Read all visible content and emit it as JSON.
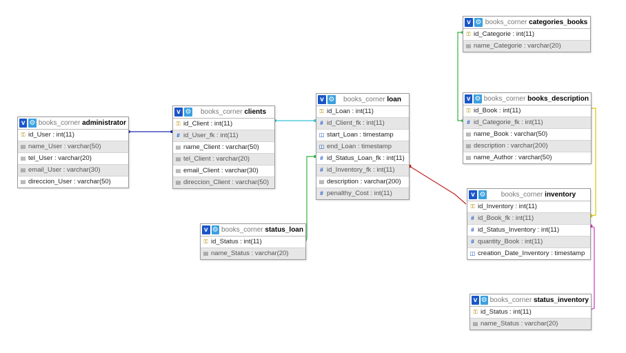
{
  "tables": {
    "administrator": {
      "db": "books_corner",
      "name": "administrator",
      "columns": [
        {
          "text": "id_User : int(11)",
          "icon": "key-icon"
        },
        {
          "text": "name_User : varchar(50)",
          "icon": "text-field-icon"
        },
        {
          "text": "tel_User : varchar(20)",
          "icon": "text-field-icon"
        },
        {
          "text": "email_User : varchar(30)",
          "icon": "text-field-icon"
        },
        {
          "text": "direccion_User : varchar(50)",
          "icon": "text-field-icon"
        }
      ]
    },
    "clients": {
      "db": "books_corner",
      "name": "clients",
      "columns": [
        {
          "text": "id_Client : int(11)",
          "icon": "key-icon"
        },
        {
          "text": "id_User_fk : int(11)",
          "icon": "number-field-icon"
        },
        {
          "text": "name_Client : varchar(50)",
          "icon": "text-field-icon"
        },
        {
          "text": "tel_Client : varchar(20)",
          "icon": "text-field-icon"
        },
        {
          "text": "email_Client : varchar(30)",
          "icon": "text-field-icon"
        },
        {
          "text": "direccion_Client : varchar(50)",
          "icon": "text-field-icon"
        }
      ]
    },
    "loan": {
      "db": "books_corner",
      "name": "loan",
      "columns": [
        {
          "text": "id_Loan : int(11)",
          "icon": "key-icon"
        },
        {
          "text": "id_Client_fk : int(11)",
          "icon": "number-field-icon"
        },
        {
          "text": "start_Loan : timestamp",
          "icon": "timestamp-field-icon"
        },
        {
          "text": "end_Loan : timestamp",
          "icon": "timestamp-field-icon"
        },
        {
          "text": "id_Status_Loan_fk : int(11)",
          "icon": "number-field-icon"
        },
        {
          "text": "id_Inventory_fk : int(11)",
          "icon": "number-field-icon"
        },
        {
          "text": "description : varchar(200)",
          "icon": "text-field-icon"
        },
        {
          "text": "penalthy_Cost : int(11)",
          "icon": "number-field-icon"
        }
      ]
    },
    "status_loan": {
      "db": "books_corner",
      "name": "status_loan",
      "columns": [
        {
          "text": "id_Status : int(11)",
          "icon": "key-icon"
        },
        {
          "text": "name_Status : varchar(20)",
          "icon": "text-field-icon"
        }
      ]
    },
    "categories_books": {
      "db": "books_corner",
      "name": "categories_books",
      "columns": [
        {
          "text": "id_Categorie : int(11)",
          "icon": "key-icon"
        },
        {
          "text": "name_Categorie : varchar(20)",
          "icon": "text-field-icon"
        }
      ]
    },
    "books_description": {
      "db": "books_corner",
      "name": "books_description",
      "columns": [
        {
          "text": "id_Book : int(11)",
          "icon": "key-icon"
        },
        {
          "text": "id_Categorie_fk : int(11)",
          "icon": "number-field-icon"
        },
        {
          "text": "name_Book : varchar(50)",
          "icon": "text-field-icon"
        },
        {
          "text": "description : varchar(200)",
          "icon": "text-field-icon"
        },
        {
          "text": "name_Author : varchar(50)",
          "icon": "text-field-icon"
        }
      ]
    },
    "inventory": {
      "db": "books_corner",
      "name": "inventory",
      "columns": [
        {
          "text": "id_Inventory : int(11)",
          "icon": "key-icon"
        },
        {
          "text": "id_Book_fk : int(11)",
          "icon": "number-field-icon"
        },
        {
          "text": "id_Status_Inventory : int(11)",
          "icon": "number-field-icon"
        },
        {
          "text": "quantity_Book : int(11)",
          "icon": "number-field-icon"
        },
        {
          "text": "creation_Date_Inventory : timestamp",
          "icon": "timestamp-field-icon"
        }
      ]
    },
    "status_inventory": {
      "db": "books_corner",
      "name": "status_inventory",
      "columns": [
        {
          "text": "id_Status : int(11)",
          "icon": "key-icon"
        },
        {
          "text": "name_Status : varchar(20)",
          "icon": "text-field-icon"
        }
      ]
    }
  },
  "ui": {
    "toggle_glyph": "v",
    "options_glyph": "⚙",
    "colors": {
      "toggle": "#1a56c8",
      "link_admin_clients": "#1f2fb0",
      "link_clients_loan": "#33c0d0",
      "link_status_loan": "#33b040",
      "link_categories": "#33b040",
      "link_loan_inventory": "#c02020",
      "link_book_inventory": "#d8c800",
      "link_status_inventory": "#d030c0"
    }
  },
  "relations": [
    {
      "from": "clients.id_User_fk",
      "to": "administrator.id_User",
      "color": "#1f2fb0"
    },
    {
      "from": "loan.id_Client_fk",
      "to": "clients.id_Client",
      "color": "#33c0d0"
    },
    {
      "from": "loan.id_Status_Loan_fk",
      "to": "status_loan.id_Status",
      "color": "#33b040"
    },
    {
      "from": "books_description.id_Categorie_fk",
      "to": "categories_books.id_Categorie",
      "color": "#33b040"
    },
    {
      "from": "loan.id_Inventory_fk",
      "to": "inventory.id_Inventory",
      "color": "#c02020"
    },
    {
      "from": "inventory.id_Book_fk",
      "to": "books_description.id_Book",
      "color": "#d8c800"
    },
    {
      "from": "inventory.id_Status_Inventory",
      "to": "status_inventory.id_Status",
      "color": "#d030c0"
    }
  ]
}
